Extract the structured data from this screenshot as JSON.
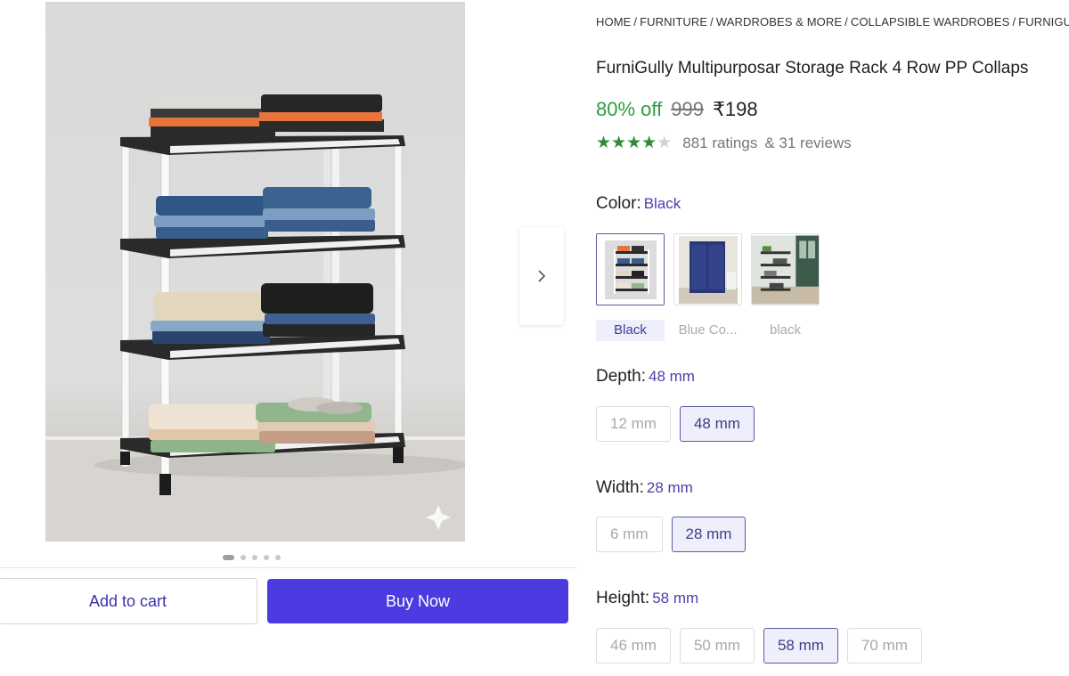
{
  "breadcrumb": {
    "items": [
      "HOME",
      "FURNITURE",
      "WARDROBES & MORE",
      "COLLAPSIBLE WARDROBES",
      "FURNIGULLY C"
    ]
  },
  "product": {
    "title": "FurniGully Multipurposar Storage Rack 4 Row PP Collaps",
    "discount": "80% off",
    "mrp": "999",
    "price": "₹198",
    "rating_stars": 4,
    "ratings_text": "881 ratings",
    "reviews_text": "& 31 reviews"
  },
  "color": {
    "label": "Color:",
    "selected_value": "Black",
    "options": [
      {
        "name": "Black",
        "selected": true,
        "icon": "rack-thumbnail-icon"
      },
      {
        "name": "Blue Co...",
        "selected": false,
        "icon": "wardrobe-thumbnail-icon"
      },
      {
        "name": "black",
        "selected": false,
        "icon": "room-thumbnail-icon"
      }
    ]
  },
  "depth": {
    "label": "Depth:",
    "selected_value": "48 mm",
    "options": [
      "12 mm",
      "48 mm"
    ]
  },
  "width": {
    "label": "Width:",
    "selected_value": "28 mm",
    "options": [
      "6 mm",
      "28 mm"
    ]
  },
  "height": {
    "label": "Height:",
    "selected_value": "58 mm",
    "options": [
      "46 mm",
      "50 mm",
      "58 mm",
      "70 mm"
    ]
  },
  "gallery": {
    "image_count": 5,
    "active_index": 0,
    "next_icon": "chevron-right-icon",
    "watermark_icon": "sparkle-icon"
  },
  "actions": {
    "add_to_cart": "Add to cart",
    "buy_now": "Buy Now"
  },
  "colors": {
    "accent": "#4b3be0",
    "discount_green": "#2e9e3e",
    "selected_text": "#4b3faa"
  }
}
